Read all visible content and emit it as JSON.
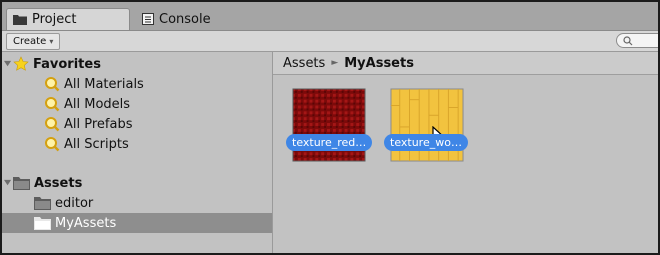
{
  "tabs": [
    {
      "label": "Project",
      "icon": "folder-icon"
    },
    {
      "label": "Console",
      "icon": "console-icon"
    }
  ],
  "toolbar": {
    "create_label": "Create",
    "create_arrow": "▾"
  },
  "tree": {
    "favorites_label": "Favorites",
    "favorites_items": [
      "All Materials",
      "All Models",
      "All Prefabs",
      "All Scripts"
    ],
    "assets_label": "Assets",
    "assets_items": [
      "editor",
      "MyAssets"
    ]
  },
  "breadcrumb": {
    "root": "Assets",
    "separator": "►",
    "current": "MyAssets"
  },
  "assets": [
    {
      "label": "texture_red…",
      "color": "#8b0d0d"
    },
    {
      "label": "texture_wo…",
      "color": "#f2c33f"
    }
  ]
}
